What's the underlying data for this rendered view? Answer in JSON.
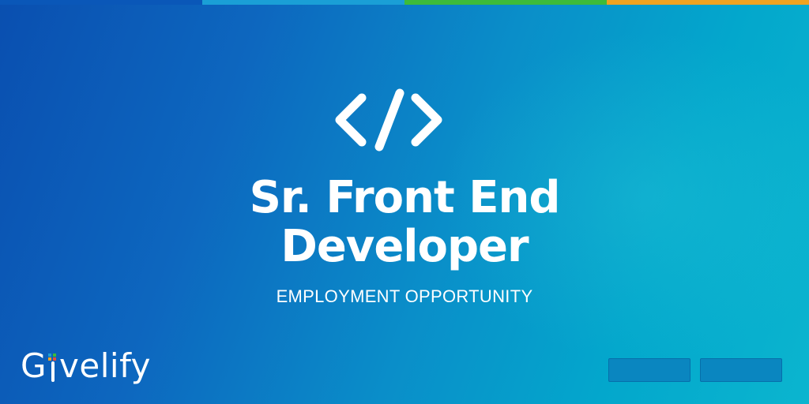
{
  "top_bar": {
    "colors": [
      "#0a57b8",
      "#1a9fd6",
      "#3dbb3a",
      "#f0a320"
    ]
  },
  "icon": {
    "name": "code-brackets-icon",
    "color": "#ffffff"
  },
  "title": {
    "line1": "Sr. Front End",
    "line2": "Developer"
  },
  "subtitle": "EMPLOYMENT OPPORTUNITY",
  "logo": {
    "part1": "G",
    "part2": "velify",
    "dot_colors": [
      "#1a9fd6",
      "#3dbb3a",
      "#f0a320",
      "#e84c3d"
    ]
  },
  "buttons": {
    "color": "#0a86c0"
  }
}
